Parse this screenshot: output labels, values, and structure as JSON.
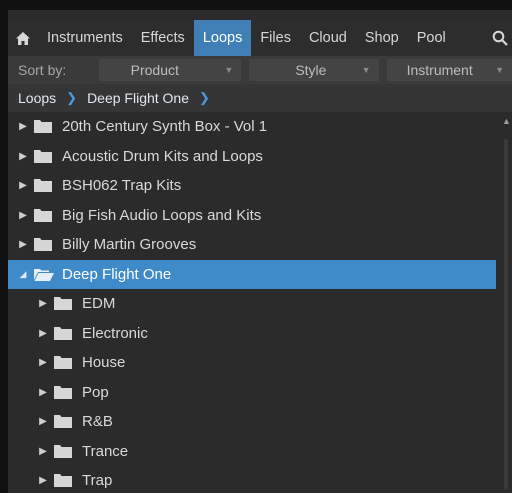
{
  "tabs": {
    "home_icon": "home-icon",
    "items": [
      "Instruments",
      "Effects",
      "Loops",
      "Files",
      "Cloud",
      "Shop",
      "Pool"
    ],
    "active": "Loops",
    "search_icon": "search-icon"
  },
  "sort": {
    "label": "Sort by:",
    "fields": [
      "Product",
      "Style",
      "Instrument"
    ]
  },
  "breadcrumb": {
    "items": [
      "Loops",
      "Deep Flight One"
    ]
  },
  "tree": {
    "items": [
      {
        "label": "20th Century Synth Box - Vol 1",
        "level": 0,
        "expanded": false,
        "selected": false
      },
      {
        "label": "Acoustic Drum Kits and Loops",
        "level": 0,
        "expanded": false,
        "selected": false
      },
      {
        "label": "BSH062 Trap Kits",
        "level": 0,
        "expanded": false,
        "selected": false
      },
      {
        "label": "Big Fish Audio Loops and Kits",
        "level": 0,
        "expanded": false,
        "selected": false
      },
      {
        "label": "Billy Martin Grooves",
        "level": 0,
        "expanded": false,
        "selected": false
      },
      {
        "label": "Deep Flight One",
        "level": 0,
        "expanded": true,
        "selected": true
      },
      {
        "label": "EDM",
        "level": 1,
        "expanded": false,
        "selected": false
      },
      {
        "label": "Electronic",
        "level": 1,
        "expanded": false,
        "selected": false
      },
      {
        "label": "House",
        "level": 1,
        "expanded": false,
        "selected": false
      },
      {
        "label": "Pop",
        "level": 1,
        "expanded": false,
        "selected": false
      },
      {
        "label": "R&B",
        "level": 1,
        "expanded": false,
        "selected": false
      },
      {
        "label": "Trance",
        "level": 1,
        "expanded": false,
        "selected": false
      },
      {
        "label": "Trap",
        "level": 1,
        "expanded": false,
        "selected": false
      }
    ]
  },
  "colors": {
    "accent": "#3f7fb6",
    "selection": "#3f8ac8",
    "background": "#2b2b2b"
  }
}
